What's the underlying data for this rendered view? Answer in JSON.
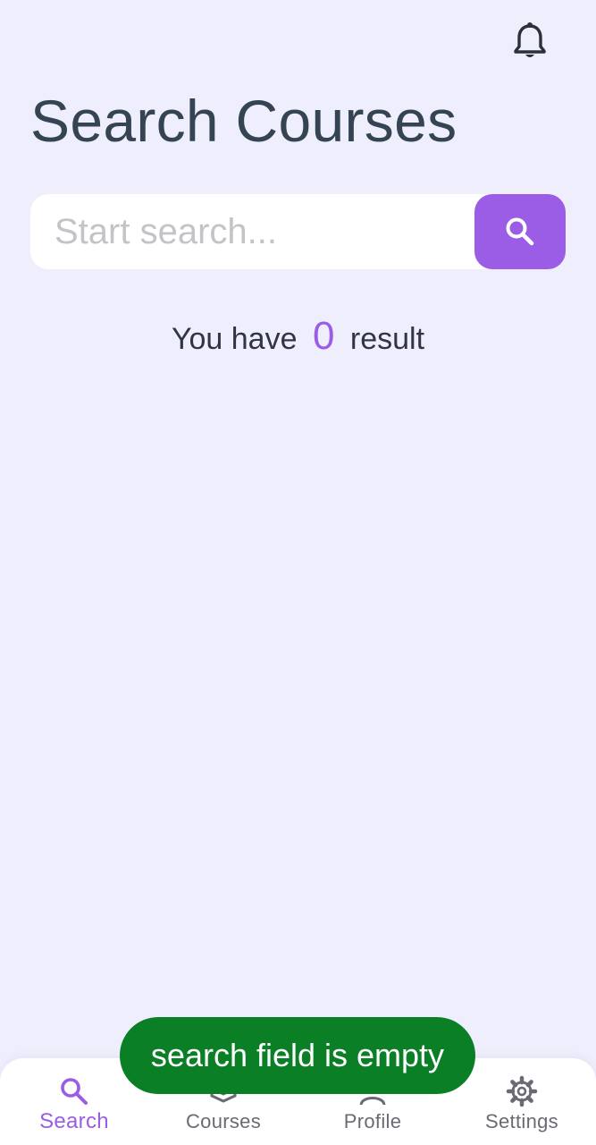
{
  "header": {
    "bell_icon": "bell-icon",
    "title": "Search Courses"
  },
  "search": {
    "value": "",
    "placeholder": "Start search...",
    "button_icon": "search-icon"
  },
  "results": {
    "prefix": "You have",
    "count": "0",
    "suffix": "result"
  },
  "toast": {
    "message": "search field is empty"
  },
  "bottom_nav": {
    "items": [
      {
        "label": "Search",
        "icon": "search-icon",
        "active": true
      },
      {
        "label": "Courses",
        "icon": "courses-icon",
        "active": false
      },
      {
        "label": "Profile",
        "icon": "profile-icon",
        "active": false
      },
      {
        "label": "Settings",
        "icon": "gear-icon",
        "active": false
      }
    ]
  },
  "colors": {
    "background": "#efeefc",
    "accent": "#9b5de5",
    "title": "#344453",
    "toast": "#0a7f25",
    "nav_inactive": "#6a6a76"
  }
}
